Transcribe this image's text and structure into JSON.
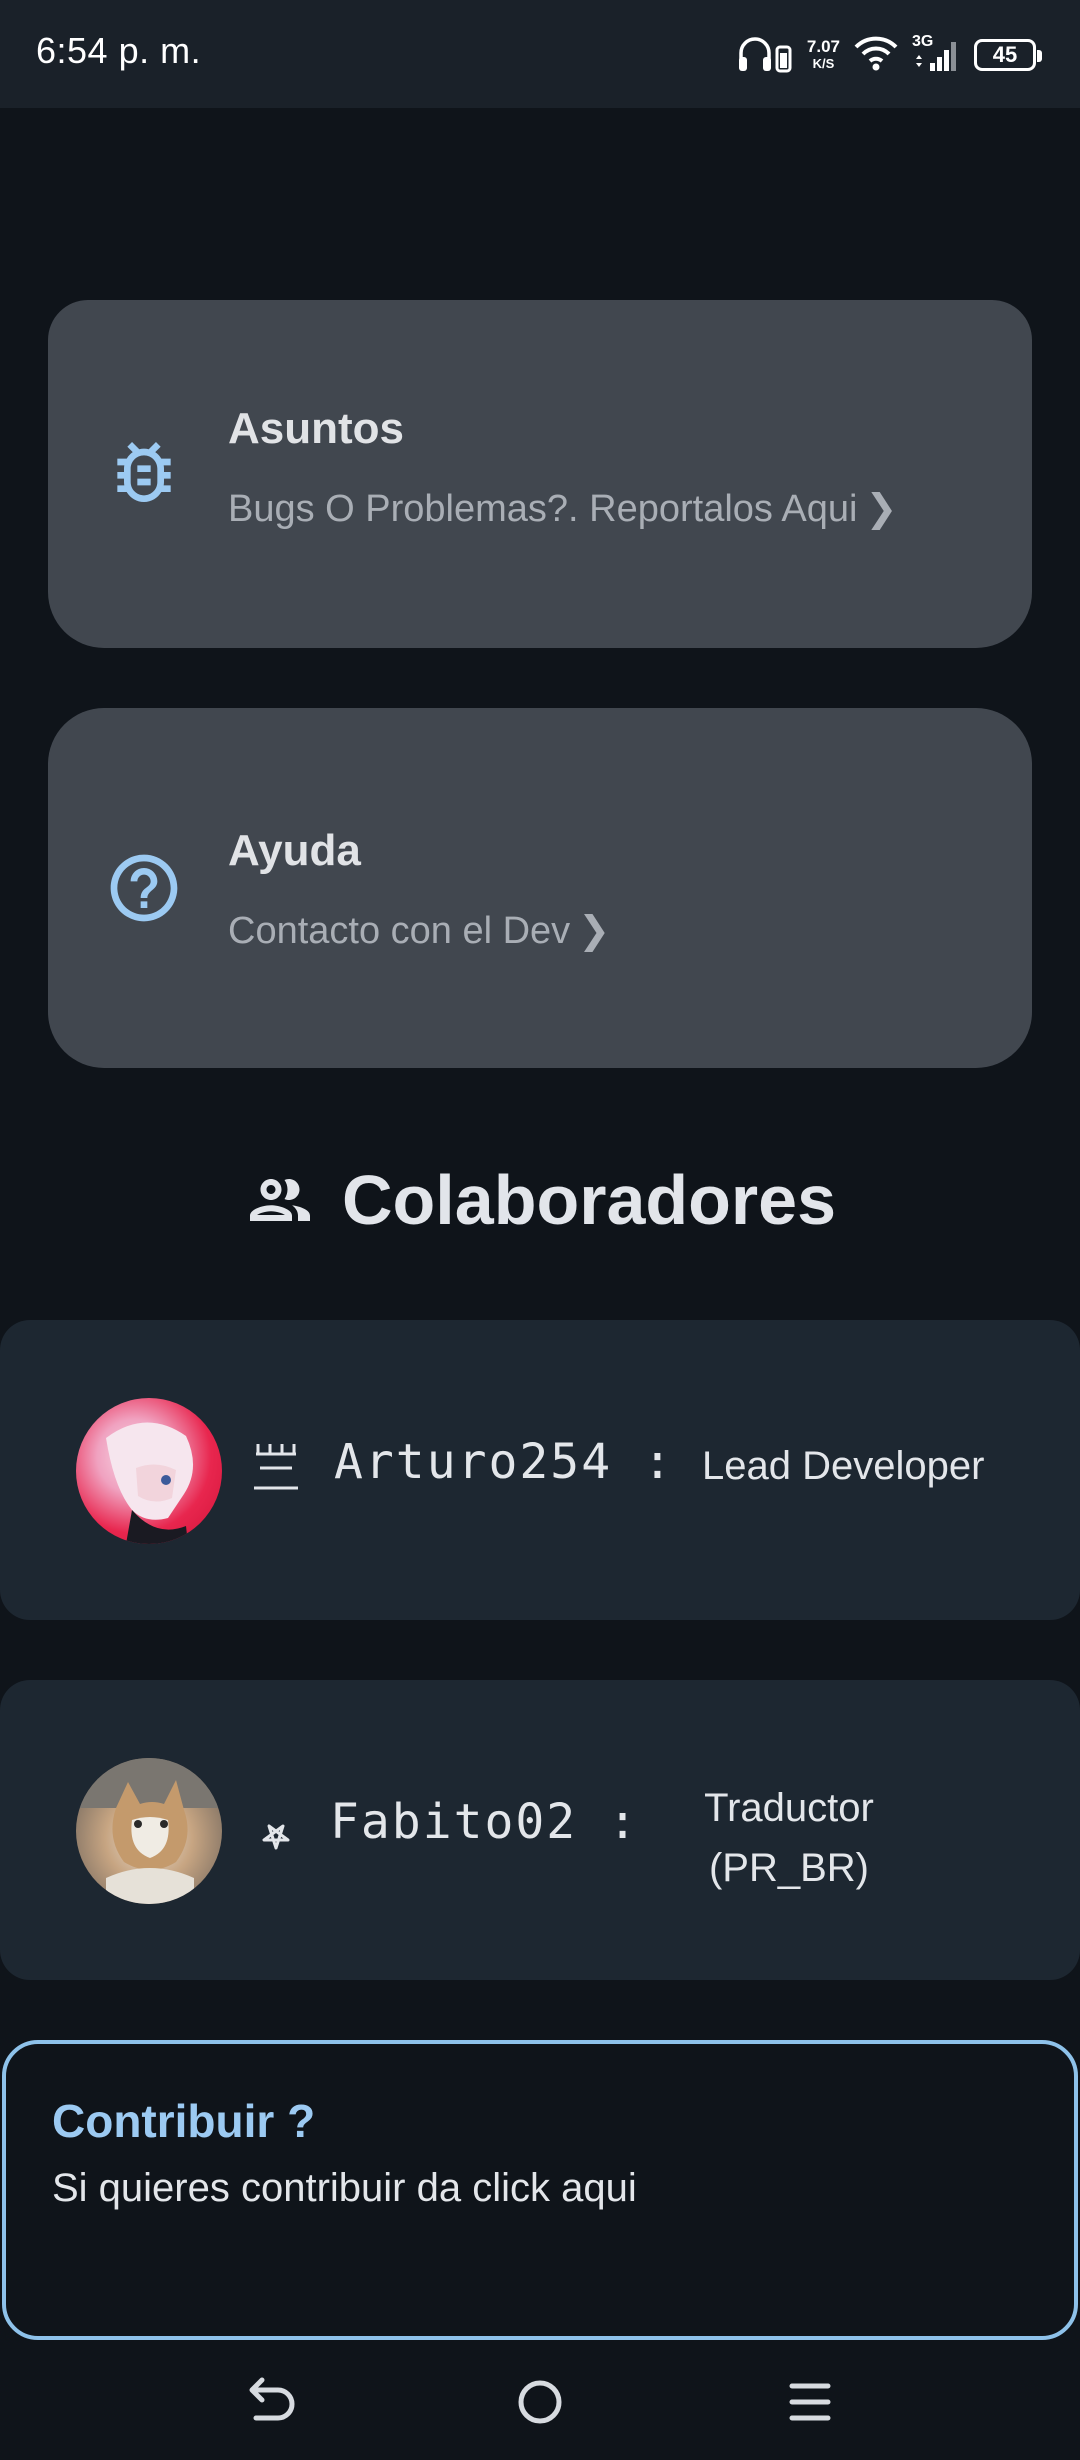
{
  "status_bar": {
    "time": "6:54 p. m.",
    "net_speed": "7.07",
    "net_speed_unit": "K/S",
    "network_type": "3G",
    "battery": "45",
    "icons": [
      "headphones-icon",
      "wifi-icon",
      "cellular-signal-icon",
      "battery-icon"
    ]
  },
  "cards": {
    "issues": {
      "icon": "bug-icon",
      "title": "Asuntos",
      "subtitle": "Bugs O Problemas?. Reportalos Aqui",
      "chevron": "❯"
    },
    "help": {
      "icon": "help-circle-icon",
      "title": "Ayuda",
      "subtitle": "Contacto con el Dev",
      "chevron": "❯"
    }
  },
  "collaborators": {
    "heading": "Colaboradores",
    "heading_icon": "people-icon",
    "items": [
      {
        "name": "Arturo254",
        "separator": ":",
        "role": "Lead Developer",
        "role_icon": "lead-developer-icon"
      },
      {
        "name": "Fabito02",
        "separator": ":",
        "role": "Traductor (PR_BR)",
        "role_icon": "pentagram-icon"
      }
    ]
  },
  "contribute": {
    "title": "Contribuir ?",
    "subtitle": "Si quieres contribuir da click aqui"
  },
  "navigation": {
    "buttons": [
      "back-icon",
      "home-icon",
      "menu-icon"
    ]
  },
  "colors": {
    "background": "#0f141a",
    "card": "#41474f",
    "collab_card": "#1d2731",
    "accent": "#9ccaf2"
  }
}
